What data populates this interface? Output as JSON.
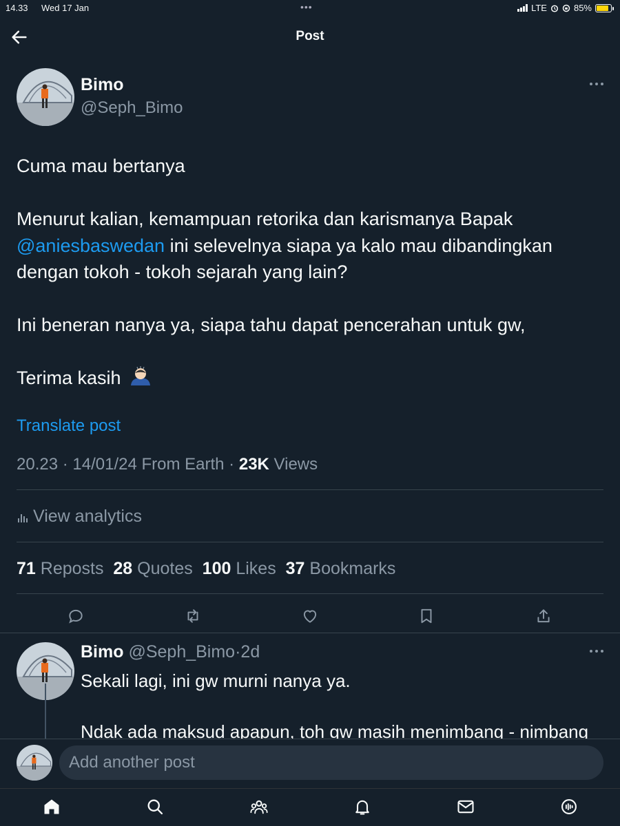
{
  "status_bar": {
    "time": "14.33",
    "date": "Wed 17 Jan",
    "network": "LTE",
    "battery": "85%",
    "battery_level": 0.85
  },
  "header": {
    "title": "Post",
    "back_icon": "arrow-left-icon"
  },
  "post": {
    "author_name": "Bimo",
    "author_handle": "@Seph_Bimo",
    "paragraphs": {
      "p1": "Cuma mau bertanya",
      "p2_before": "Menurut kalian, kemampuan retorika dan karismanya Bapak",
      "p2_mention": "@aniesbaswedan",
      "p2_after": " ini selevelnya siapa ya kalo mau dibandingkan dengan tokoh - tokoh sejarah yang lain?",
      "p3": "Ini beneran nanya ya, siapa tahu dapat pencerahan untuk gw,",
      "p4": "Terima kasih",
      "p4_emoji": "person-bowing-emoji"
    },
    "translate_label": "Translate post",
    "timestamp": "20.23 · 14/01/24",
    "source": "From Earth",
    "views_count": "23K",
    "views_label": "Views",
    "analytics_label": "View analytics",
    "stats": {
      "reposts_count": "71",
      "reposts_label": "Reposts",
      "quotes_count": "28",
      "quotes_label": "Quotes",
      "likes_count": "100",
      "likes_label": "Likes",
      "bookmarks_count": "37",
      "bookmarks_label": "Bookmarks"
    },
    "actions": [
      "reply-icon",
      "repost-icon",
      "like-icon",
      "bookmark-icon",
      "share-icon"
    ]
  },
  "reply": {
    "author_name": "Bimo",
    "author_handle": "@Seph_Bimo",
    "time_ago": "2d",
    "line1": "Sekali lagi, ini gw murni nanya ya.",
    "line2": "Ndak ada maksud apapun, toh gw masih menimbang - nimbang"
  },
  "composer": {
    "placeholder": "Add another post"
  },
  "tabbar": [
    "home-icon",
    "search-icon",
    "communities-icon",
    "notifications-icon",
    "messages-icon",
    "grok-icon"
  ],
  "colors": {
    "background": "#15202b",
    "accent": "#1d9bf0",
    "secondary_text": "#8b98a5"
  }
}
